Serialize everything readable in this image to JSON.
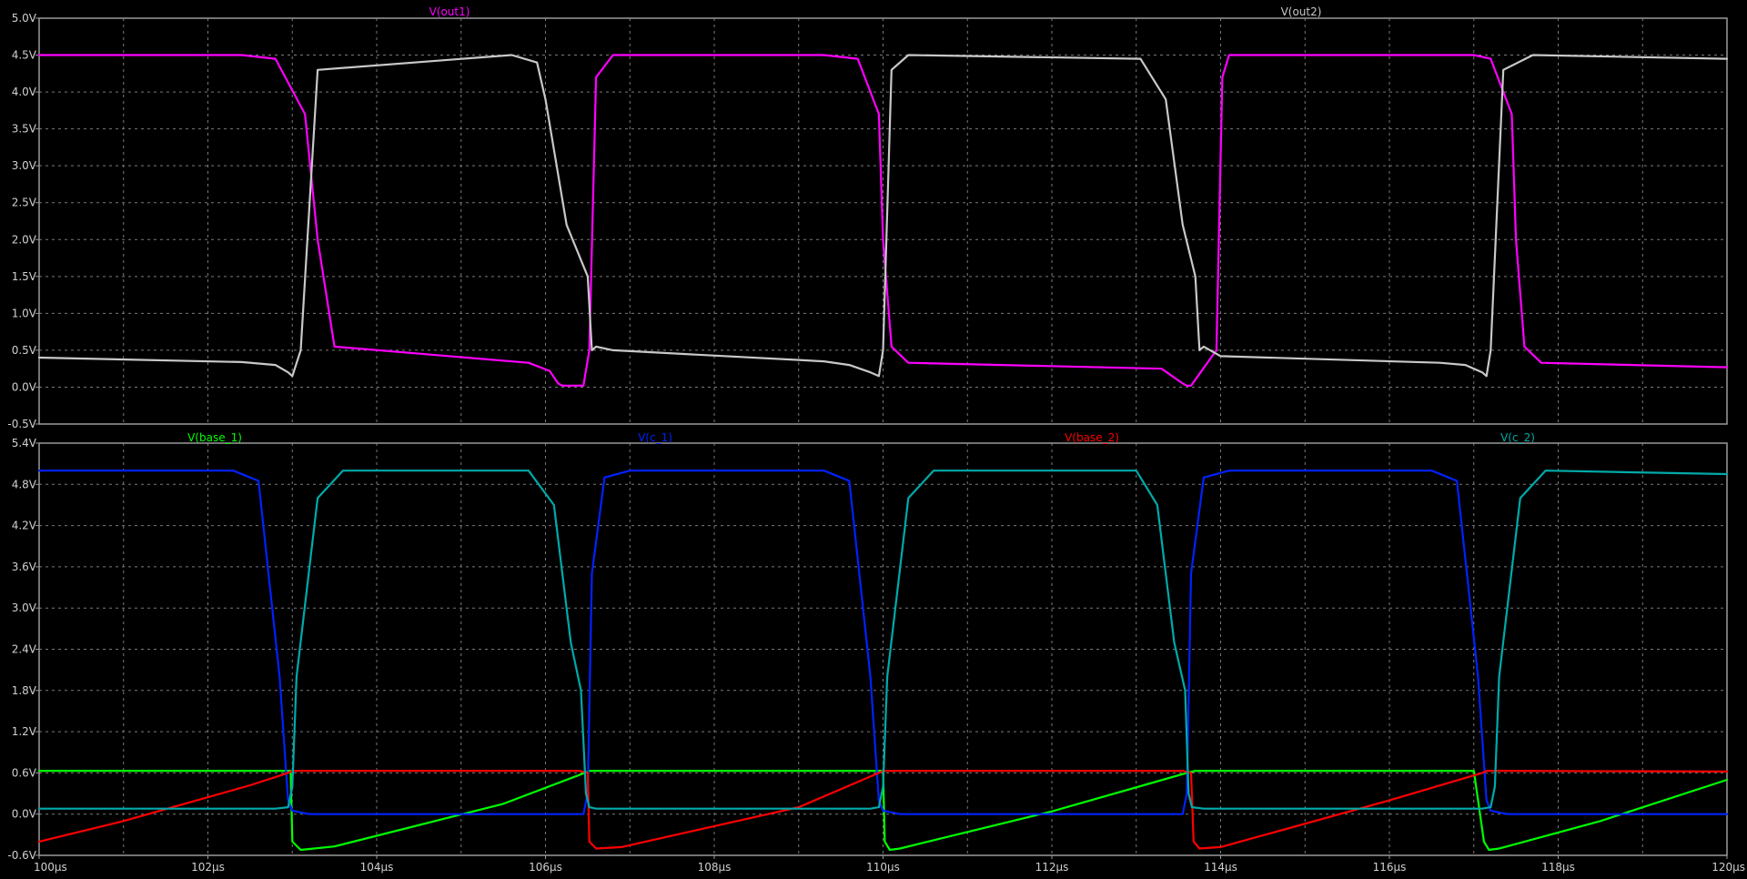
{
  "background_color": "#000000",
  "grid_color": "#7a7a7a",
  "frame_color": "#9a9a9a",
  "tick_label_color": "#d0d0d0",
  "chart_data": [
    {
      "type": "line",
      "grid": true,
      "xlim": [
        100,
        120
      ],
      "ylim": [
        -0.5,
        5.0
      ],
      "ytick_labels": [
        "5.0V",
        "4.5V",
        "4.0V",
        "3.5V",
        "3.0V",
        "2.5V",
        "2.0V",
        "1.5V",
        "1.0V",
        "0.5V",
        "0.0V",
        "-0.5V"
      ],
      "ytick_values": [
        5.0,
        4.5,
        4.0,
        3.5,
        3.0,
        2.5,
        2.0,
        1.5,
        1.0,
        0.5,
        0.0,
        -0.5
      ],
      "series": [
        {
          "name": "V(out1)",
          "color": "#ff00ff",
          "x": [
            100,
            102.4,
            102.8,
            103.15,
            103.3,
            103.5,
            105.8,
            106.05,
            106.15,
            106.2,
            106.45,
            106.52,
            106.6,
            106.8,
            109.3,
            109.7,
            109.95,
            110.0,
            110.1,
            110.3,
            113.3,
            113.55,
            113.6,
            113.65,
            113.95,
            114.02,
            114.1,
            114.3,
            117.0,
            117.2,
            117.45,
            117.5,
            117.6,
            117.8,
            120
          ],
          "y": [
            4.5,
            4.5,
            4.45,
            3.7,
            2.0,
            0.55,
            0.33,
            0.22,
            0.05,
            0.02,
            0.02,
            0.5,
            4.2,
            4.5,
            4.5,
            4.45,
            3.7,
            2.0,
            0.55,
            0.33,
            0.25,
            0.05,
            0.02,
            0.02,
            0.5,
            4.2,
            4.5,
            4.5,
            4.5,
            4.45,
            3.7,
            2.0,
            0.55,
            0.33,
            0.27
          ]
        },
        {
          "name": "V(out2)",
          "color": "#c8c8c8",
          "x": [
            100,
            102.4,
            102.8,
            102.95,
            103.0,
            103.1,
            103.3,
            105.6,
            105.9,
            106.0,
            106.25,
            106.5,
            106.55,
            106.6,
            106.8,
            109.3,
            109.6,
            109.85,
            109.95,
            110.0,
            110.1,
            110.3,
            113.05,
            113.35,
            113.55,
            113.7,
            113.75,
            113.8,
            114.0,
            116.6,
            116.9,
            117.1,
            117.15,
            117.2,
            117.35,
            117.7,
            120
          ],
          "y": [
            0.4,
            0.34,
            0.3,
            0.2,
            0.15,
            0.5,
            4.3,
            4.5,
            4.4,
            3.9,
            2.2,
            1.5,
            0.5,
            0.55,
            0.5,
            0.35,
            0.3,
            0.2,
            0.15,
            0.5,
            4.3,
            4.5,
            4.45,
            3.9,
            2.2,
            1.5,
            0.5,
            0.55,
            0.42,
            0.33,
            0.3,
            0.2,
            0.15,
            0.5,
            4.3,
            4.5,
            4.45
          ]
        }
      ]
    },
    {
      "type": "line",
      "grid": true,
      "xlim": [
        100,
        120
      ],
      "ylim": [
        -0.6,
        5.4
      ],
      "xlabel_ticks": [
        "100µs",
        "102µs",
        "104µs",
        "106µs",
        "108µs",
        "110µs",
        "112µs",
        "114µs",
        "116µs",
        "118µs",
        "120µs"
      ],
      "xtick_values": [
        100,
        102,
        104,
        106,
        108,
        110,
        112,
        114,
        116,
        118,
        120
      ],
      "ytick_labels": [
        "5.4V",
        "4.8V",
        "4.2V",
        "3.6V",
        "3.0V",
        "2.4V",
        "1.8V",
        "1.2V",
        "0.6V",
        "0.0V",
        "-0.6V"
      ],
      "ytick_values": [
        5.4,
        4.8,
        4.2,
        3.6,
        3.0,
        2.4,
        1.8,
        1.2,
        0.6,
        0.0,
        -0.6
      ],
      "series": [
        {
          "name": "V(base_1)",
          "color": "#00ff00",
          "x": [
            100,
            102.9,
            102.98,
            103.0,
            103.1,
            103.5,
            105.5,
            106.4,
            106.5,
            106.52,
            109.6,
            110.0,
            110.02,
            110.08,
            110.2,
            112.0,
            113.6,
            113.7,
            113.72,
            117.0,
            117.12,
            117.18,
            117.3,
            118.5,
            120
          ],
          "y": [
            0.63,
            0.63,
            0.63,
            -0.4,
            -0.52,
            -0.47,
            0.15,
            0.57,
            0.62,
            0.63,
            0.63,
            0.63,
            -0.4,
            -0.52,
            -0.5,
            0.04,
            0.6,
            0.63,
            0.63,
            0.63,
            -0.4,
            -0.52,
            -0.5,
            -0.1,
            0.5
          ]
        },
        {
          "name": "V(c_1)",
          "color": "#0022ff",
          "x": [
            100,
            102.3,
            102.6,
            102.85,
            102.95,
            103.0,
            103.2,
            106.45,
            106.5,
            106.55,
            106.7,
            107.0,
            109.3,
            109.6,
            109.85,
            109.95,
            110.0,
            110.2,
            113.55,
            113.6,
            113.65,
            113.8,
            114.1,
            116.5,
            116.8,
            117.05,
            117.15,
            117.2,
            117.4,
            120
          ],
          "y": [
            5.0,
            5.0,
            4.85,
            2.0,
            0.2,
            0.05,
            0.0,
            0.0,
            0.3,
            3.5,
            4.9,
            5.0,
            5.0,
            4.85,
            2.0,
            0.2,
            0.05,
            0.0,
            0.0,
            0.3,
            3.5,
            4.9,
            5.0,
            5.0,
            4.85,
            2.0,
            0.2,
            0.05,
            0.0,
            0.0
          ]
        },
        {
          "name": "V(base_2)",
          "color": "#ff0000",
          "x": [
            100,
            101.0,
            102.5,
            102.95,
            103.0,
            106.4,
            106.5,
            106.52,
            106.6,
            106.9,
            109.0,
            109.95,
            110.0,
            113.55,
            113.65,
            113.68,
            113.75,
            114.0,
            116.0,
            117.1,
            117.15,
            120
          ],
          "y": [
            -0.4,
            -0.1,
            0.42,
            0.6,
            0.63,
            0.63,
            0.6,
            -0.4,
            -0.5,
            -0.48,
            0.1,
            0.6,
            0.63,
            0.63,
            0.6,
            -0.4,
            -0.5,
            -0.48,
            0.2,
            0.6,
            0.63,
            0.62
          ]
        },
        {
          "name": "V(c_2)",
          "color": "#00aaaa",
          "x": [
            100,
            102.8,
            102.95,
            103.0,
            103.05,
            103.3,
            103.6,
            105.8,
            106.1,
            106.3,
            106.42,
            106.48,
            106.52,
            106.6,
            109.85,
            109.95,
            110.0,
            110.05,
            110.3,
            110.6,
            113.0,
            113.25,
            113.45,
            113.58,
            113.62,
            113.66,
            113.8,
            117.1,
            117.2,
            117.25,
            117.3,
            117.55,
            117.85,
            120
          ],
          "y": [
            0.08,
            0.08,
            0.1,
            0.4,
            2.0,
            4.6,
            5.0,
            5.0,
            4.5,
            2.5,
            1.8,
            0.3,
            0.1,
            0.08,
            0.08,
            0.1,
            0.4,
            2.0,
            4.6,
            5.0,
            5.0,
            4.5,
            2.5,
            1.8,
            0.3,
            0.1,
            0.08,
            0.08,
            0.1,
            0.4,
            2.0,
            4.6,
            5.0,
            4.95
          ]
        }
      ]
    }
  ]
}
